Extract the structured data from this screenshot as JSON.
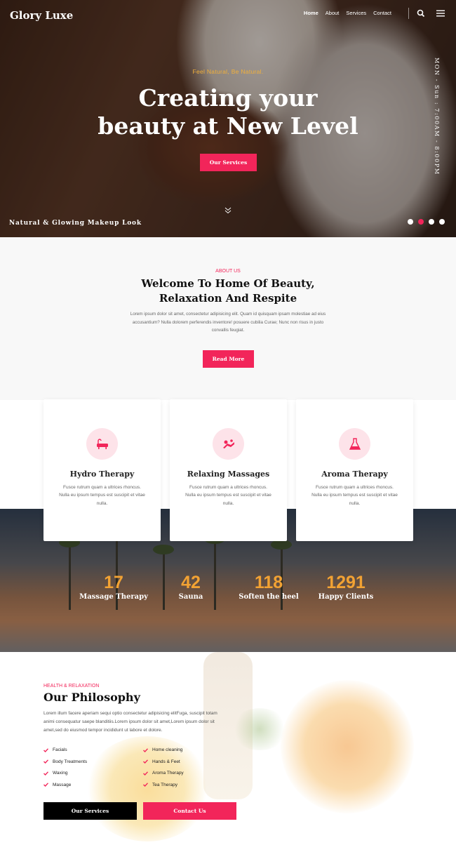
{
  "header": {
    "logo": "Glory Luxe",
    "nav": [
      "Home",
      "About",
      "Services",
      "Contact"
    ]
  },
  "hero": {
    "tagline": "Feel Natural, Be Natural.",
    "title_line1": "Creating your",
    "title_line2": "beauty at New Level",
    "button": "Our Services",
    "caption": "Natural & Glowing Makeup Look",
    "hours": "MON - Sun : 7:00AM - 8:00PM",
    "slide_count": 4,
    "active_slide": 2
  },
  "about": {
    "eyebrow": "ABOUT US",
    "title_line1": "Welcome To Home Of Beauty,",
    "title_line2": "Relaxation And Respite",
    "text": "Lorem ipsum dolor sit amet, consectetur adipisicing elit. Quam id quisquam ipsam molestiae ad eius accusantium? Nulla dolorem perferendis inventore! posuere cubilia Curae; Nunc non risus in justo convallis feugiat.",
    "button": "Read More"
  },
  "services": [
    {
      "title": "Hydro Therapy",
      "text": "Fusce rutrum quam a ultrices rhoncus. Nulla eu ipsum tempus est suscipit et vitae nulla.",
      "icon": "bathtub-icon"
    },
    {
      "title": "Relaxing Massages",
      "text": "Fusce rutrum quam a ultrices rhoncus. Nulla eu ipsum tempus est suscipit et vitae nulla.",
      "icon": "massage-icon"
    },
    {
      "title": "Aroma Therapy",
      "text": "Fusce rutrum quam a ultrices rhoncus. Nulla eu ipsum tempus est suscipit et vitae nulla.",
      "icon": "flask-icon"
    }
  ],
  "stats": [
    {
      "num": "17",
      "label": "Massage Therapy"
    },
    {
      "num": "42",
      "label": "Sauna"
    },
    {
      "num": "118",
      "label": "Soften the heel"
    },
    {
      "num": "1291",
      "label": "Happy Clients"
    }
  ],
  "philosophy": {
    "eyebrow": "HEALTH & RELAXATION",
    "title": "Our Philosophy",
    "text": "Lorem illum facere aperiam sequi optio consectetur adipisicing elitFuga, suscipit totam animi consequatur saepe blanditiis.Lorem ipsum dolor sit amet,Lorem ipsum dolor sit amet,sed do eiusmod tempor incididunt ut labore et dolore.",
    "checklist": [
      "Facials",
      "Home cleaning",
      "Body Treatments",
      "Hands & Feet",
      "Waxing",
      "Aroma Therapy",
      "Massage",
      "Tea Therapy"
    ],
    "button_primary": "Our Services",
    "button_secondary": "Contact Us"
  },
  "colors": {
    "accent": "#f2255a",
    "stat": "#f2a233",
    "dark": "#000000"
  }
}
